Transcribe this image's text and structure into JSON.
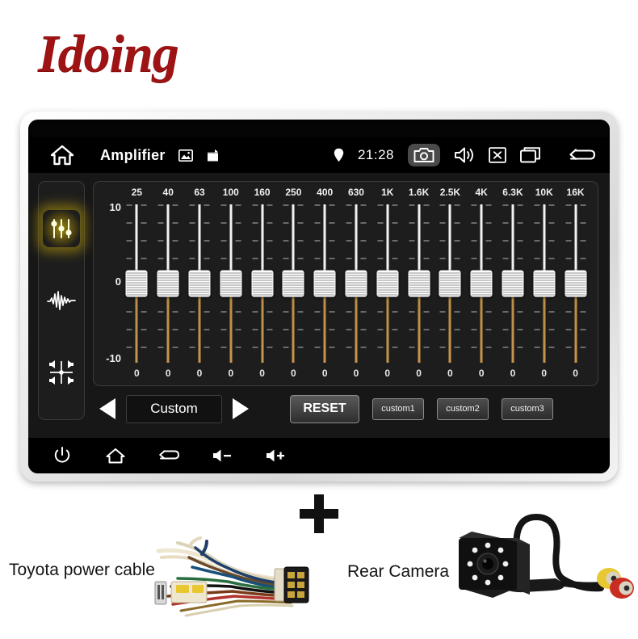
{
  "brand": {
    "name": "Idoing"
  },
  "device": {
    "statusbar": {
      "home_icon": "home-icon",
      "title": "Amplifier",
      "image_icon": "image-icon",
      "bag_icon": "bag-icon",
      "location_icon": "location-pin-icon",
      "time": "21:28",
      "camera_icon": "camera-icon",
      "volume_icon": "speaker-icon",
      "close_icon": "close-box-icon",
      "recents_icon": "recents-icon",
      "back_icon": "back-arrow-icon"
    },
    "rail": {
      "items": [
        {
          "name": "equalizer-icon",
          "label": "Equalizer",
          "active": true
        },
        {
          "name": "waveform-icon",
          "label": "Waveform",
          "active": false
        },
        {
          "name": "balance-fader-icon",
          "label": "Balance / Fader",
          "active": false
        }
      ]
    },
    "equalizer": {
      "axis": {
        "top": "10",
        "mid": "0",
        "bottom": "-10"
      },
      "bands": [
        "25",
        "40",
        "63",
        "100",
        "160",
        "250",
        "400",
        "630",
        "1K",
        "1.6K",
        "2.5K",
        "4K",
        "6.3K",
        "10K",
        "16K"
      ],
      "values": [
        "0",
        "0",
        "0",
        "0",
        "0",
        "0",
        "0",
        "0",
        "0",
        "0",
        "0",
        "0",
        "0",
        "0",
        "0"
      ]
    },
    "controls": {
      "prev_icon": "arrow-left-icon",
      "preset": "Custom",
      "next_icon": "arrow-right-icon",
      "reset_label": "RESET",
      "custom_presets": [
        "custom1",
        "custom2",
        "custom3"
      ]
    },
    "navbar": {
      "items": [
        {
          "name": "power-icon",
          "label": "Power"
        },
        {
          "name": "home-icon",
          "label": "Home"
        },
        {
          "name": "back-icon",
          "label": "Back"
        },
        {
          "name": "volume-down-icon",
          "label": "Volume Down"
        },
        {
          "name": "volume-up-icon",
          "label": "Volume Up"
        }
      ]
    }
  },
  "accessories": {
    "plus_symbol": "+",
    "cable_label": "Toyota power cable",
    "camera_label": "Rear Camera"
  },
  "colors": {
    "brand_red": "#9e1313",
    "screen_black": "#050505",
    "panel_dark": "#1d1d1d",
    "slider_track_upper": "#f2f2f2",
    "slider_track_lower": "#c8964a",
    "active_glow": "#bea00a"
  }
}
